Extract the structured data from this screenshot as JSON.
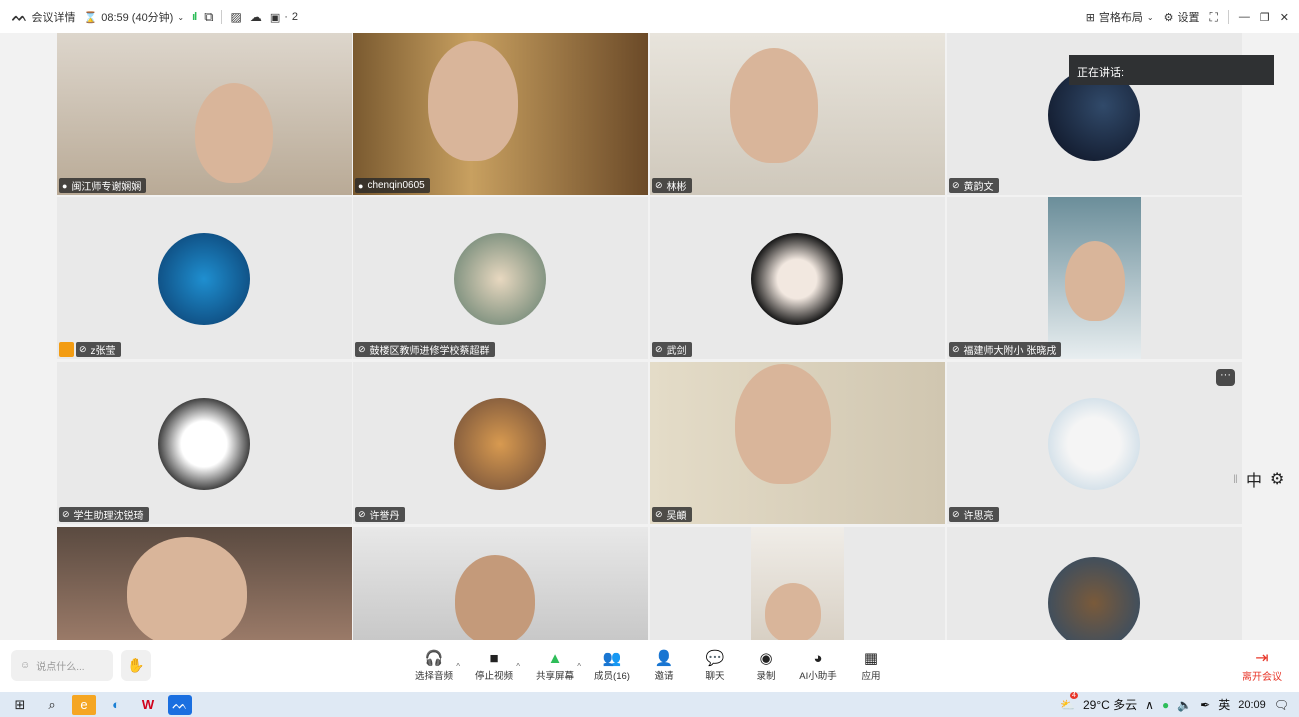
{
  "topbar": {
    "meeting_details": "会议详情",
    "timer": "08:59 (40分钟)",
    "device_count": "2",
    "layout_label": "宫格布局",
    "settings_label": "设置"
  },
  "speaker_popup": {
    "label": "正在讲话:"
  },
  "participants": [
    {
      "name": "闽江师专谢娴娴",
      "kind": "video"
    },
    {
      "name": "chenqin0605",
      "kind": "video"
    },
    {
      "name": "林彬",
      "kind": "video"
    },
    {
      "name": "黄韵文",
      "kind": "avatar"
    },
    {
      "name": "z张莹",
      "kind": "avatar",
      "host": true
    },
    {
      "name": "鼓楼区教师进修学校蔡超群",
      "kind": "avatar"
    },
    {
      "name": "武剑",
      "kind": "avatar"
    },
    {
      "name": "福建师大附小 张晓戌",
      "kind": "video"
    },
    {
      "name": "学生助理沈锐琦",
      "kind": "avatar"
    },
    {
      "name": "许誉丹",
      "kind": "avatar"
    },
    {
      "name": "吴頔",
      "kind": "video"
    },
    {
      "name": "许思亮",
      "kind": "avatar"
    },
    {
      "name": "",
      "kind": "video"
    },
    {
      "name": "",
      "kind": "video"
    },
    {
      "name": "",
      "kind": "video"
    },
    {
      "name": "",
      "kind": "avatar"
    }
  ],
  "side_float": {
    "lang": "中"
  },
  "toolbar": {
    "chat_placeholder": "说点什么...",
    "audio": "选择音频",
    "video": "停止视频",
    "share": "共享屏幕",
    "members": "成员(16)",
    "invite": "邀请",
    "chat": "聊天",
    "record": "录制",
    "ai": "AI小助手",
    "apps": "应用",
    "leave": "离开会议"
  },
  "taskbar": {
    "weather": "29°C 多云",
    "ime": "英",
    "time": "20:09",
    "weather_badge": "4"
  },
  "colors": {
    "accent_green": "#2ebd59",
    "leave_red": "#e8372a",
    "host_orange": "#f39c12"
  }
}
